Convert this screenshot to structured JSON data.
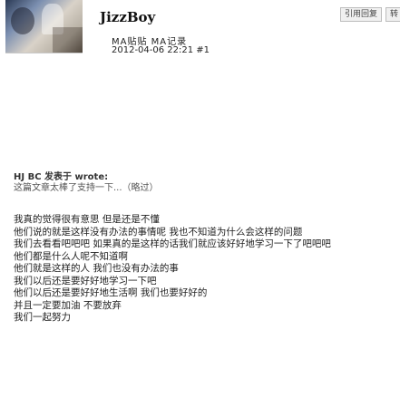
{
  "author": {
    "name": "JizzBoy",
    "meta": "MA贴贴 MA记录",
    "time": "2012-04-06 22:21 #1"
  },
  "buttons": [
    "引用回复",
    "转"
  ],
  "quote": {
    "author_line": "HJ BC 发表于 wrote:",
    "text": "这篇文章太棒了支持一下...（略过）"
  },
  "body_lines": [
    "我真的觉得很有意思 但是还是不懂",
    "他们说的就是这样没有办法的事情呢 我也不知道为什么会这样的问题",
    "我们去看看吧吧吧 如果真的是这样的话我们就应该好好地学习一下了吧吧吧",
    "他们都是什么人呢不知道啊",
    "他们就是这样的人 我们也没有办法的事",
    "我们以后还是要好好地学习一下吧",
    "他们以后还是要好好地生活啊 我们也要好好的",
    "并且一定要加油 不要放弃",
    "我们一起努力"
  ],
  "colors": {
    "text": "#222222",
    "quote_text": "#555555",
    "button_bg": "#f0f0f0",
    "button_border": "#bdbdbd"
  }
}
